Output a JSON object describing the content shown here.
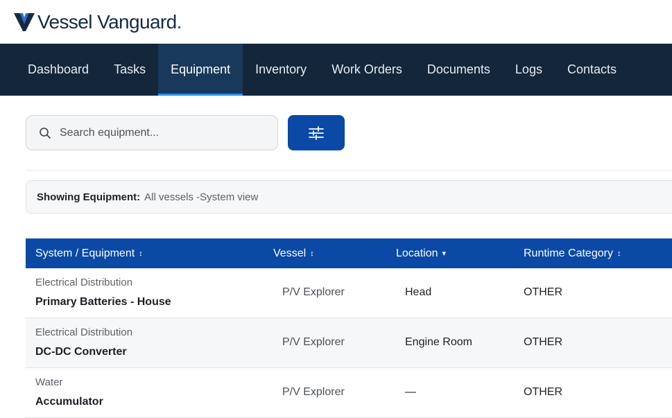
{
  "brand": {
    "name": "Vessel Vanguard",
    "trademark_dot": ".",
    "color": "#142b44",
    "accent": "#0a4aa6"
  },
  "nav": {
    "items": [
      {
        "label": "Dashboard",
        "active": false
      },
      {
        "label": "Tasks",
        "active": false
      },
      {
        "label": "Equipment",
        "active": true
      },
      {
        "label": "Inventory",
        "active": false
      },
      {
        "label": "Work Orders",
        "active": false
      },
      {
        "label": "Documents",
        "active": false
      },
      {
        "label": "Logs",
        "active": false
      },
      {
        "label": "Contacts",
        "active": false
      }
    ],
    "background": "#13263a"
  },
  "search": {
    "placeholder": "Search equipment...",
    "value": "",
    "icon": "search-icon"
  },
  "filter_button": {
    "icon": "sliders-icon",
    "color": "#0a4aa6"
  },
  "showing": {
    "label": "Showing Equipment:",
    "value": "All vessels -System view"
  },
  "table": {
    "header_color": "#0a4aa6",
    "columns": [
      {
        "label": "System / Equipment",
        "sort": "↕"
      },
      {
        "label": "Vessel",
        "sort": "↕"
      },
      {
        "label": "Location",
        "sort": "▾"
      },
      {
        "label": "Runtime Category",
        "sort": "↕"
      }
    ],
    "rows": [
      {
        "system": "Electrical Distribution",
        "equipment": "Primary Batteries - House",
        "vessel": "P/V Explorer",
        "location": "Head",
        "runtime": "OTHER"
      },
      {
        "system": "Electrical Distribution",
        "equipment": "DC-DC Converter",
        "vessel": "P/V Explorer",
        "location": "Engine Room",
        "runtime": "OTHER"
      },
      {
        "system": "Water",
        "equipment": "Accumulator",
        "vessel": "P/V Explorer",
        "location": "—",
        "runtime": "OTHER"
      }
    ]
  }
}
